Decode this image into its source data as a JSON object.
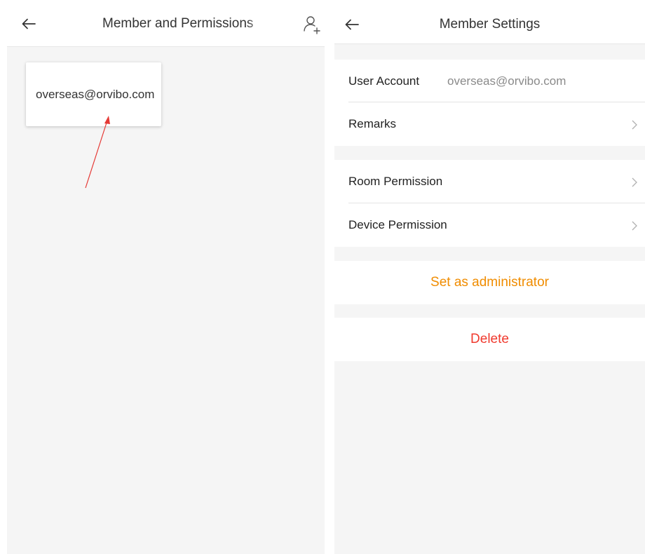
{
  "left_screen": {
    "header": {
      "title": "Member and Permissions",
      "back_icon": "arrow-left-icon",
      "add_icon": "add-person-icon"
    },
    "member_card": {
      "account": "overseas@orvibo.com"
    },
    "annotation_color": "#e53935"
  },
  "right_screen": {
    "header": {
      "title": "Member Settings",
      "back_icon": "arrow-left-icon"
    },
    "user_account": {
      "label": "User Account",
      "value": "overseas@orvibo.com"
    },
    "remarks": {
      "label": "Remarks"
    },
    "room_permission": {
      "label": "Room Permission"
    },
    "device_permission": {
      "label": "Device Permission"
    },
    "set_admin": {
      "label": "Set as administrator",
      "color": "#f08c00"
    },
    "delete": {
      "label": "Delete",
      "color": "#f03a2e"
    }
  }
}
